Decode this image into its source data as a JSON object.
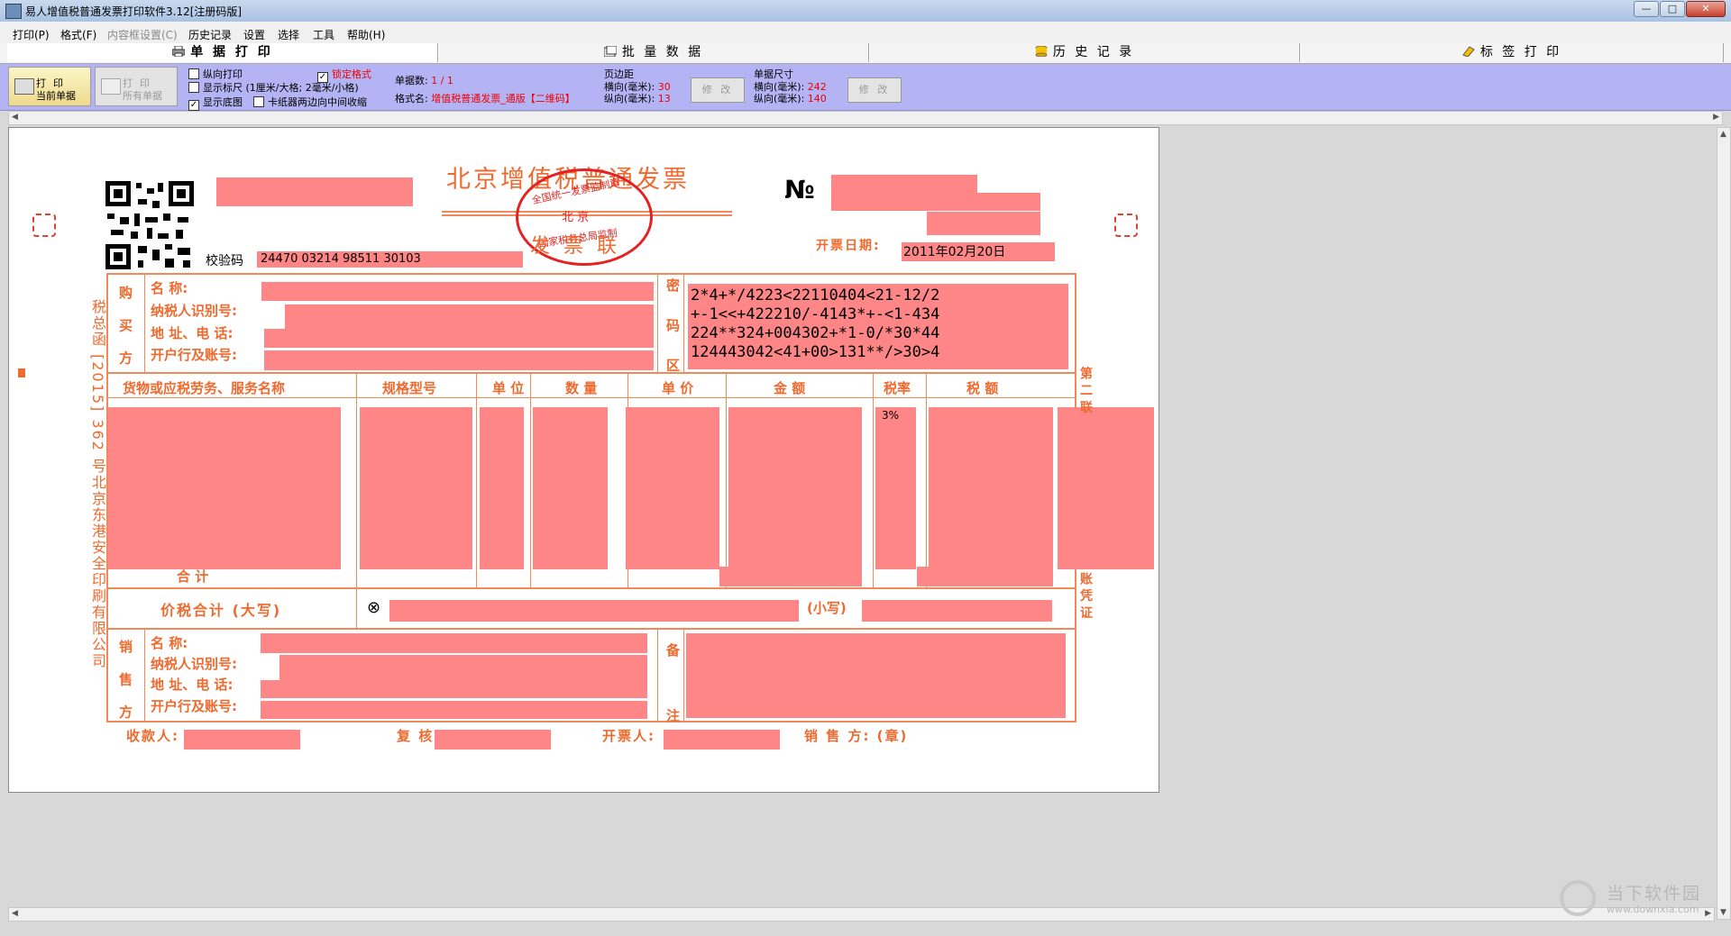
{
  "window": {
    "title": "易人增值税普通发票打印软件3.12[注册码版]",
    "buttons": [
      "—",
      "□",
      "✕"
    ]
  },
  "menu": [
    {
      "label": "打印(P)",
      "enabled": true
    },
    {
      "label": "格式(F)",
      "enabled": true
    },
    {
      "label": "内容框设置(C)",
      "enabled": false
    },
    {
      "label": "历史记录",
      "enabled": true
    },
    {
      "label": "设置",
      "enabled": true
    },
    {
      "label": "选择",
      "enabled": true
    },
    {
      "label": "工具",
      "enabled": true
    },
    {
      "label": "帮助(H)",
      "enabled": true
    }
  ],
  "tabs": [
    {
      "label": "单 据 打 印",
      "icon": "printer-icon",
      "active": true
    },
    {
      "label": "批 量 数 据",
      "icon": "batch-data-icon",
      "active": false
    },
    {
      "label": "历 史 记 录",
      "icon": "database-icon",
      "active": false
    },
    {
      "label": "标 签 打 印",
      "icon": "label-icon",
      "active": false
    }
  ],
  "toolbar": {
    "print_current": {
      "line1": "打印",
      "line2": "当前单据"
    },
    "print_all": {
      "line1": "打印",
      "line2": "所有单据"
    },
    "checks": [
      {
        "label": "纵向打印",
        "checked": false
      },
      {
        "label": "锁定格式",
        "checked": true
      },
      {
        "label": "显示标尺 (1厘米/大格; 2毫米/小格)",
        "checked": false
      },
      {
        "label": "显示底图",
        "checked": true
      },
      {
        "label": "卡纸器两边向中间收缩",
        "checked": false
      }
    ],
    "doc_count_label": "单据数:",
    "doc_count_value": "1 / 1",
    "format_label": "格式名:",
    "format_value": "增值税普通发票_通版【二维码】",
    "margin_title": "页边距",
    "margin_h_label": "横向(毫米):",
    "margin_h_value": "30",
    "margin_v_label": "纵向(毫米):",
    "margin_v_value": "13",
    "size_title": "单据尺寸",
    "size_h_label": "横向(毫米):",
    "size_h_value": "242",
    "size_v_label": "纵向(毫米):",
    "size_v_value": "140",
    "modify_label": "修 改"
  },
  "invoice": {
    "title": "北京增值税普通发票",
    "no_symbol": "№",
    "stamp_top": "全国统一发票监制章",
    "stamp_mid": "北  京",
    "stamp_bottom": "国家税务总局监制",
    "copy_label": "发 票 联",
    "check_code_label": "校验码",
    "check_code": "24470 03214 98511 30103",
    "date_label": "开票日期:",
    "date_value": "2011年02月20日",
    "left_side": "税总函 [2015] 362 号北京东港安全印刷有限公司",
    "buyer_label": "购 买 方",
    "field_name": "名          称:",
    "field_taxid": "纳税人识别号:",
    "field_addr": "地 址、电 话:",
    "field_bank": "开户行及账号:",
    "cipher_label": "密 码 区",
    "cipher_lines": [
      "2*4+*/4223<22110404<21-12/2",
      "+-1<<+422210/-4143*+-<1-434",
      "224**324+004302+*1-0/*30*44",
      "124443042<41+00>131**/>30>4"
    ],
    "columns": [
      "货物或应税劳务、服务名称",
      "规格型号",
      "单 位",
      "数  量",
      "单  价",
      "金     额",
      "税率",
      "税     额"
    ],
    "tax_rate": "3%",
    "total_label": "合          计",
    "price_tax_label": "价税合计 (大写)",
    "small_label": "(小写)",
    "seller_label": "销 售 方",
    "remarks_label": "备 注",
    "footer_payee": "收款人:",
    "footer_review": "复 核:",
    "footer_drawer": "开票人:",
    "footer_seller": "销 售 方: (章)",
    "right_side_top": "第 二 联",
    "right_side_bottom": "账 凭 证"
  },
  "watermark": {
    "title": "当下软件园",
    "url": "www.downxia.com"
  }
}
